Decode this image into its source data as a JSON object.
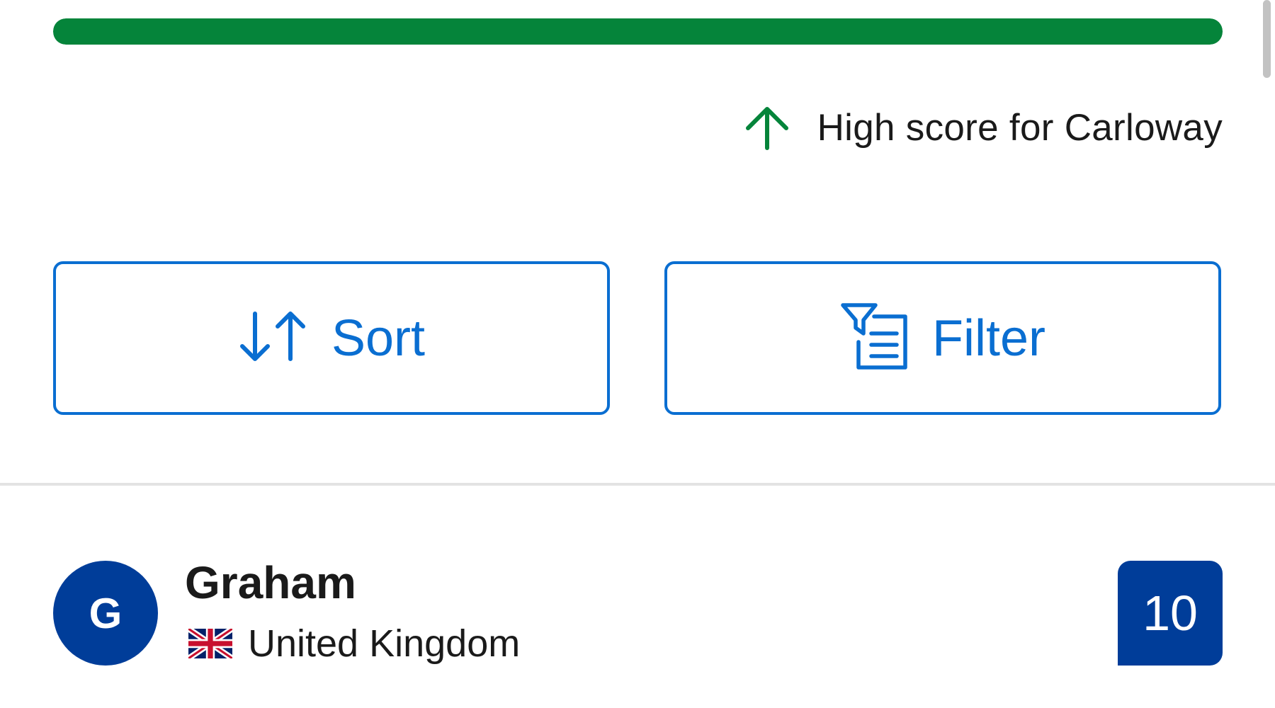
{
  "score_bar": {
    "fill_fraction": 1.0,
    "color": "#05843a"
  },
  "high_score": {
    "icon": "arrow-up-icon",
    "label": "High score for Carloway",
    "color": "#05843a"
  },
  "actions": {
    "sort": {
      "icon": "sort-arrows-icon",
      "label": "Sort"
    },
    "filter": {
      "icon": "filter-list-icon",
      "label": "Filter"
    },
    "accent": "#0a6ed1"
  },
  "entries": [
    {
      "initial": "G",
      "name": "Graham",
      "flag_icon": "uk-flag-icon",
      "country": "United Kingdom",
      "score": "10",
      "color": "#003d99"
    }
  ]
}
